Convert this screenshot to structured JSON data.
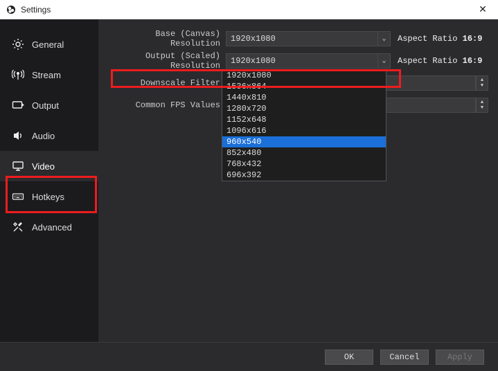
{
  "window": {
    "title": "Settings"
  },
  "sidebar": {
    "items": [
      {
        "label": "General"
      },
      {
        "label": "Stream"
      },
      {
        "label": "Output"
      },
      {
        "label": "Audio"
      },
      {
        "label": "Video"
      },
      {
        "label": "Hotkeys"
      },
      {
        "label": "Advanced"
      }
    ]
  },
  "video": {
    "base_label": "Base (Canvas) Resolution",
    "base_value": "1920x1080",
    "base_aspect_label": "Aspect Ratio",
    "base_aspect_value": "16:9",
    "output_label": "Output (Scaled) Resolution",
    "output_value": "1920x1080",
    "output_aspect_label": "Aspect Ratio",
    "output_aspect_value": "16:9",
    "filter_label": "Downscale Filter",
    "fps_label": "Common FPS Values",
    "resolutions": [
      "1920x1080",
      "1536x864",
      "1440x810",
      "1280x720",
      "1152x648",
      "1096x616",
      "960x540",
      "852x480",
      "768x432",
      "696x392"
    ],
    "highlight_index": 6
  },
  "footer": {
    "ok": "OK",
    "cancel": "Cancel",
    "apply": "Apply"
  }
}
